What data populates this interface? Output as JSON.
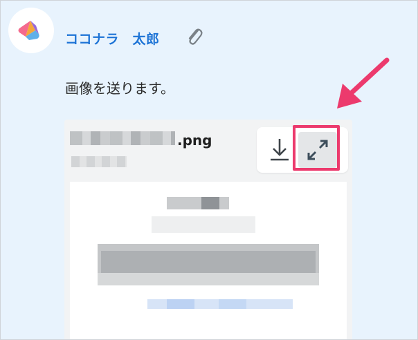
{
  "sender": {
    "name": "ココナラ　太郎",
    "avatar_icon": "coconala-logo-icon",
    "attachment_icon": "paperclip-icon"
  },
  "message": {
    "text": "画像を送ります。"
  },
  "attachment": {
    "filename_visible": ".png",
    "download_icon": "download-icon",
    "expand_icon": "expand-icon"
  },
  "colors": {
    "background": "#e8f3fd",
    "sender_name": "#1e74d6",
    "highlight": "#ec3a6d",
    "arrow": "#ec3a6d"
  }
}
